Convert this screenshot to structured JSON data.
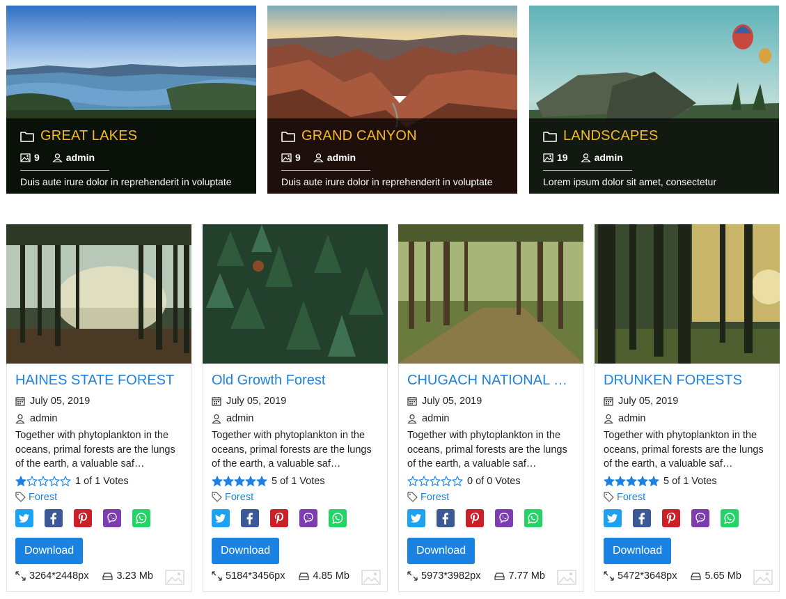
{
  "colors": {
    "accent_blue": "#1a82e3",
    "category_title": "#f5b921",
    "star_filled": "#1a82e3",
    "twitter": "#1da1f2",
    "facebook": "#3b5998",
    "pinterest": "#cb2027",
    "viber": "#7d3daf",
    "whatsapp": "#25d366"
  },
  "categories": [
    {
      "icon": "folder-icon",
      "title": "GREAT LAKES",
      "image_count": "9",
      "author": "admin",
      "description": "Duis aute irure dolor in reprehenderit in voluptate"
    },
    {
      "icon": "folder-icon",
      "title": "GRAND CANYON",
      "image_count": "9",
      "author": "admin",
      "description": "Duis aute irure dolor in reprehenderit in voluptate"
    },
    {
      "icon": "folder-icon",
      "title": "LANDSCAPES",
      "image_count": "19",
      "author": "admin",
      "description": "Lorem ipsum dolor sit amet, consectetur"
    }
  ],
  "cards": [
    {
      "title": "HAINES STATE FOREST",
      "date": "July 05, 2019",
      "author": "admin",
      "excerpt": "Together with phytoplankton in the oceans, primal forests are the lungs of the earth, a valuable saf…",
      "stars_filled": 1,
      "stars_total": 5,
      "rating_text": "1 of 1 Votes",
      "tag": "Forest",
      "download_label": "Download",
      "dimensions": "3264*2448px",
      "size": "3.23 Mb"
    },
    {
      "title": "Old Growth Forest",
      "date": "July 05, 2019",
      "author": "admin",
      "excerpt": "Together with phytoplankton in the oceans, primal forests are the lungs of the earth, a valuable saf…",
      "stars_filled": 5,
      "stars_total": 5,
      "rating_text": "5 of 1 Votes",
      "tag": "Forest",
      "download_label": "Download",
      "dimensions": "5184*3456px",
      "size": "4.85 Mb"
    },
    {
      "title": "CHUGACH NATIONAL …",
      "date": "July 05, 2019",
      "author": "admin",
      "excerpt": "Together with phytoplankton in the oceans, primal forests are the lungs of the earth, a valuable saf…",
      "stars_filled": 0,
      "stars_total": 5,
      "rating_text": "0 of 0 Votes",
      "tag": "Forest",
      "download_label": "Download",
      "dimensions": "5973*3982px",
      "size": "7.77 Mb"
    },
    {
      "title": "DRUNKEN FORESTS",
      "date": "July 05, 2019",
      "author": "admin",
      "excerpt": "Together with phytoplankton in the oceans, primal forests are the lungs of the earth, a valuable saf…",
      "stars_filled": 5,
      "stars_total": 5,
      "rating_text": "5 of 1 Votes",
      "tag": "Forest",
      "download_label": "Download",
      "dimensions": "5472*3648px",
      "size": "5.65 Mb"
    }
  ],
  "share_icons": [
    "twitter-icon",
    "facebook-icon",
    "pinterest-icon",
    "viber-icon",
    "whatsapp-icon"
  ]
}
